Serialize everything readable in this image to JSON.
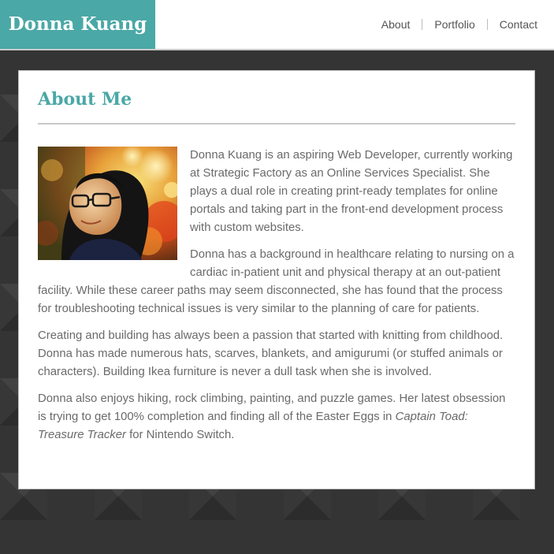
{
  "header": {
    "brand": "Donna Kuang",
    "nav": [
      {
        "label": "About"
      },
      {
        "label": "Portfolio"
      },
      {
        "label": "Contact"
      }
    ]
  },
  "main": {
    "title": "About Me",
    "photo_alt": "Portrait photo of Donna Kuang",
    "paragraphs": [
      "Donna Kuang is an aspiring Web Developer, currently working at Strategic Factory as an Online Services Specialist. She plays a dual role in creating print-ready templates for online portals and taking part in the front-end development process with custom websites.",
      "Donna has a background in healthcare relating to nursing on a cardiac in-patient unit and physical therapy at an out-patient facility. While these career paths may seem disconnected, she has found that the process for troubleshooting technical issues is very similar to the planning of care for patients.",
      "Creating and building has always been a passion that started with knitting from childhood. Donna has made numerous hats, scarves, blankets, and amigurumi (or stuffed animals or characters). Building Ikea furniture is never a dull task when she is involved."
    ],
    "last_paragraph": {
      "before": "Donna also enjoys hiking, rock climbing, painting, and puzzle games. Her latest obsession is trying to get 100% completion and finding all of the Easter Eggs in ",
      "italic": "Captain Toad: Treasure Tracker",
      "after": " for Nintendo Switch."
    }
  },
  "colors": {
    "accent": "#4aa8a6",
    "page_background": "#343434",
    "text": "#6a6a6a"
  }
}
